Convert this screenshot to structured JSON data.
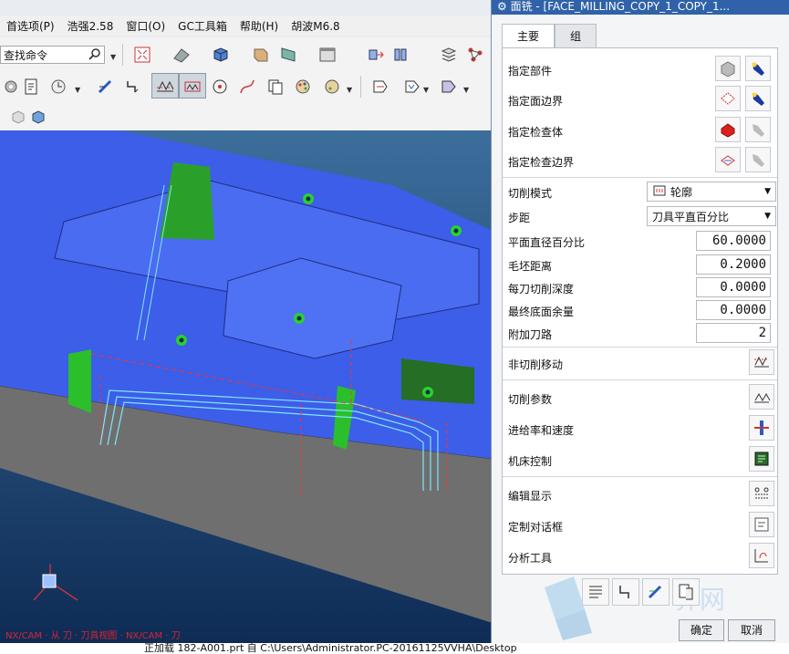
{
  "menubar": {
    "items": [
      "首选项(P)",
      "浩强2.58",
      "窗口(O)",
      "GC工具箱",
      "帮助(H)",
      "胡波M6.8"
    ]
  },
  "command_finder": {
    "label": "查找命令"
  },
  "viewport": {
    "overlay_text": "NX/CAM · 从 刀 · 刀具视图 · NX/CAM · 刀"
  },
  "statusbar": {
    "text": "正加载 182-A001.prt 自 C:\\Users\\Administrator.PC-20161125VVHA\\Desktop"
  },
  "dialog": {
    "title": "面铣 - [FACE_MILLING_COPY_1_COPY_1...",
    "tabs": [
      "主要",
      "组"
    ],
    "geometry": [
      {
        "label": "指定部件",
        "icon": "part-icon"
      },
      {
        "label": "指定面边界",
        "icon": "face-boundary-icon"
      },
      {
        "label": "指定检查体",
        "icon": "check-body-icon"
      },
      {
        "label": "指定检查边界",
        "icon": "check-boundary-icon"
      }
    ],
    "cut_pattern": {
      "label": "切削模式",
      "value": "轮廓"
    },
    "stepover": {
      "label": "步距",
      "value": "刀具平直百分比"
    },
    "flat_percent": {
      "label": "平面直径百分比",
      "value": "60.0000"
    },
    "blank_distance": {
      "label": "毛坯距离",
      "value": "0.2000"
    },
    "depth_per_cut": {
      "label": "每刀切削深度",
      "value": "0.0000"
    },
    "final_floor_stock": {
      "label": "最终底面余量",
      "value": "0.0000"
    },
    "extra_passes": {
      "label": "附加刀路",
      "value": "2"
    },
    "actions": [
      {
        "label": "非切削移动",
        "icon": "non-cutting-moves-icon"
      },
      {
        "label": "切削参数",
        "icon": "cutting-params-icon"
      },
      {
        "label": "进给率和速度",
        "icon": "feeds-speeds-icon"
      },
      {
        "label": "机床控制",
        "icon": "machine-control-icon"
      },
      {
        "label": "编辑显示",
        "icon": "edit-display-icon"
      },
      {
        "label": "定制对话框",
        "icon": "customize-dialog-icon"
      },
      {
        "label": "分析工具",
        "icon": "analysis-tool-icon"
      }
    ],
    "ok": "确定",
    "cancel": "取消",
    "watermark": "界网"
  }
}
